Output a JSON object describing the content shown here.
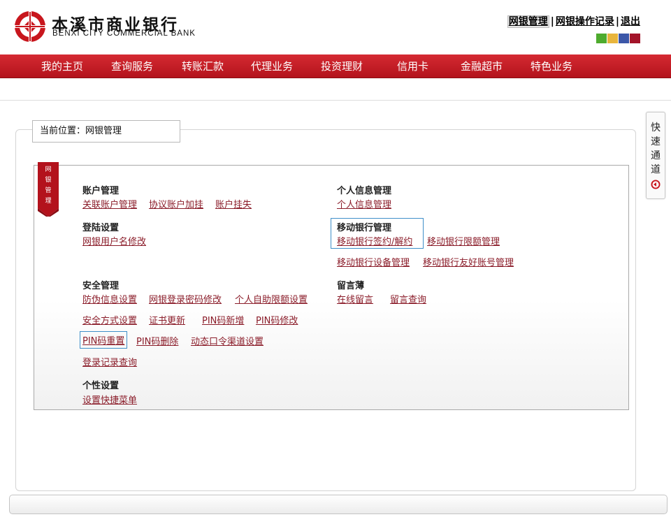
{
  "brand": {
    "name_cn": "本溪市商业银行",
    "name_en": "BENXI CITY COMMERCIAL BANK",
    "logo_icon": "bank-logo-icon"
  },
  "toplinks": {
    "manage": "网银管理",
    "sep1": "|",
    "records": "网银操作记录",
    "sep2": "|",
    "logout": "退出"
  },
  "theme_swatches": [
    "#4eab2e",
    "#e8b53d",
    "#3c57a8",
    "#a3142a"
  ],
  "nav": [
    "我的主页",
    "查询服务",
    "转账汇款",
    "代理业务",
    "投资理财",
    "信用卡",
    "金融超市",
    "特色业务"
  ],
  "breadcrumb": "当前位置：网银管理",
  "ribbon": [
    "网",
    "银",
    "管",
    "理"
  ],
  "sections": {
    "account": {
      "title": "账户管理",
      "links": [
        "关联账户管理",
        "协议账户加挂",
        "账户挂失"
      ]
    },
    "login": {
      "title": "登陆设置",
      "links": [
        "网银用户名修改"
      ]
    },
    "security": {
      "title": "安全管理",
      "links": [
        "防伪信息设置",
        "网银登录密码修改",
        "个人自助限额设置",
        "安全方式设置",
        "证书更新",
        "PIN码新增",
        "PIN码修改",
        "PIN码重置",
        "PIN码删除",
        "动态口令渠道设置",
        "登录记录查询"
      ]
    },
    "personal": {
      "title": "个性设置",
      "links": [
        "设置快捷菜单"
      ]
    },
    "info": {
      "title": "个人信息管理",
      "links": [
        "个人信息管理"
      ]
    },
    "mobile": {
      "title": "移动银行管理",
      "links": [
        "移动银行签约/解约",
        "移动银行限额管理",
        "移动银行设备管理",
        "移动银行友好账号管理"
      ]
    },
    "message": {
      "title": "留言薄",
      "links": [
        "在线留言",
        "留言查询"
      ]
    }
  },
  "quick_access": {
    "label": [
      "快",
      "速",
      "通",
      "道"
    ],
    "icon": "arrow-left-circle-icon"
  }
}
